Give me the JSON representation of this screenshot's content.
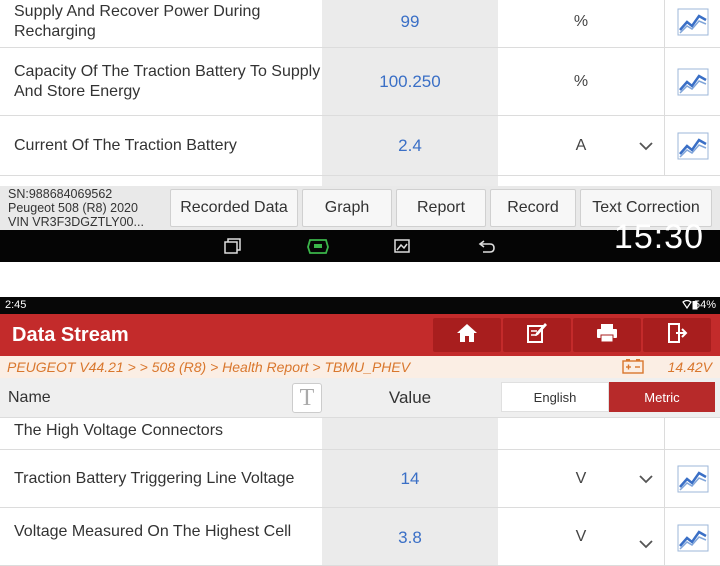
{
  "upper": {
    "rows": [
      {
        "name": "Supply And Recover Power During Recharging",
        "value": "99",
        "unit": "%"
      },
      {
        "name": "Capacity Of The Traction Battery To Supply And Store Energy",
        "value": "100.250",
        "unit": "%"
      },
      {
        "name": "Current Of The Traction Battery",
        "value": "2.4",
        "unit": "A"
      }
    ],
    "vehicle": {
      "sn": "SN:988684069562",
      "model": "Peugeot 508 (R8) 2020",
      "vin": "VIN VR3F3DGZTLY00..."
    },
    "toolbar": {
      "recorded_data": "Recorded Data",
      "graph": "Graph",
      "report": "Report",
      "record": "Record",
      "text_correction": "Text Correction"
    },
    "clock": "15:30"
  },
  "lower": {
    "status": {
      "time": "2:45",
      "battery": "54%"
    },
    "header": {
      "title": "Data Stream"
    },
    "breadcrumb": {
      "path": "PEUGEOT V44.21 >  > 508 (R8) > Health Report > TBMU_PHEV",
      "voltage": "14.42V"
    },
    "columns": {
      "name": "Name",
      "value": "Value",
      "text_toggle": "T",
      "english": "English",
      "metric": "Metric"
    },
    "rows": [
      {
        "name": "The High Voltage Connectors",
        "value": "",
        "unit": ""
      },
      {
        "name": "Traction Battery Triggering Line Voltage",
        "value": "14",
        "unit": "V"
      },
      {
        "name": "Voltage Measured On The Highest Cell",
        "value": "3.8",
        "unit": "V"
      }
    ]
  },
  "colors": {
    "header_red": "#c32b2b",
    "value_blue": "#3a6fc6",
    "breadcrumb_orange": "#d9772d"
  }
}
